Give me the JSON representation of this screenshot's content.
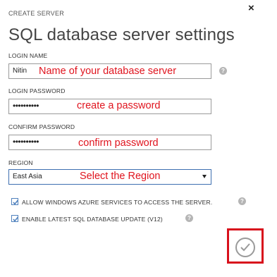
{
  "dialog": {
    "label": "CREATE SERVER",
    "title": "SQL database server settings",
    "close": "×"
  },
  "fields": {
    "login_name": {
      "label": "LOGIN NAME",
      "value": "Nitin",
      "annotation": "Name of your database server"
    },
    "login_password": {
      "label": "LOGIN PASSWORD",
      "value": "••••••••••",
      "annotation": "create a password"
    },
    "confirm_password": {
      "label": "CONFIRM PASSWORD",
      "value": "••••••••••",
      "annotation": "confirm password"
    },
    "region": {
      "label": "REGION",
      "value": "East Asia",
      "annotation": "Select the Region"
    }
  },
  "options": {
    "allow_azure": {
      "label": "ALLOW WINDOWS AZURE SERVICES TO ACCESS THE SERVER.",
      "checked": true
    },
    "enable_update": {
      "label": "ENABLE LATEST SQL DATABASE UPDATE (V12)",
      "checked": true
    }
  },
  "help_glyph": "?",
  "colors": {
    "annotation": "#e0141e",
    "highlight": "#d8101c",
    "checkbox": "#4f81bd"
  }
}
